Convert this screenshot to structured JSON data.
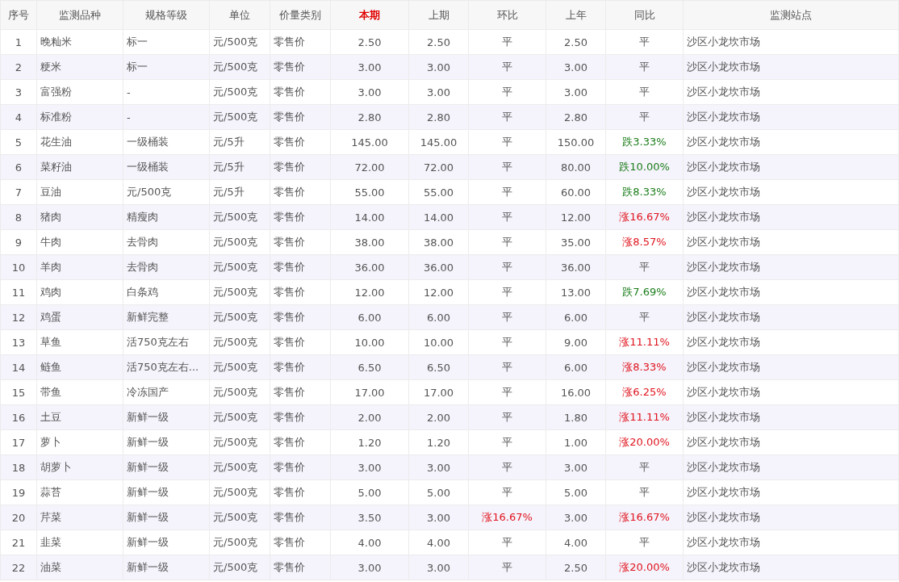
{
  "table": {
    "columns": [
      {
        "label": "序号",
        "highlighted": false
      },
      {
        "label": "监测品种",
        "highlighted": false
      },
      {
        "label": "规格等级",
        "highlighted": false
      },
      {
        "label": "单位",
        "highlighted": false
      },
      {
        "label": "价量类别",
        "highlighted": false
      },
      {
        "label": "本期",
        "highlighted": true
      },
      {
        "label": "上期",
        "highlighted": false
      },
      {
        "label": "环比",
        "highlighted": false
      },
      {
        "label": "上年",
        "highlighted": false
      },
      {
        "label": "同比",
        "highlighted": false
      },
      {
        "label": "监测站点",
        "highlighted": false
      }
    ],
    "rows": [
      {
        "no": "1",
        "item": "晚籼米",
        "grade": "标一",
        "unit": "元/500克",
        "price_type": "零售价",
        "current": "2.50",
        "previous": "2.50",
        "mom": "平",
        "mom_rising": false,
        "mom_falling": false,
        "last_year": "2.50",
        "yoy": "平",
        "yoy_rising": false,
        "yoy_falling": false,
        "station": "沙区小龙坎市场"
      },
      {
        "no": "2",
        "item": "粳米",
        "grade": "标一",
        "unit": "元/500克",
        "price_type": "零售价",
        "current": "3.00",
        "previous": "3.00",
        "mom": "平",
        "mom_rising": false,
        "mom_falling": false,
        "last_year": "3.00",
        "yoy": "平",
        "yoy_rising": false,
        "yoy_falling": false,
        "station": "沙区小龙坎市场"
      },
      {
        "no": "3",
        "item": "富强粉",
        "grade": "-",
        "unit": "元/500克",
        "price_type": "零售价",
        "current": "3.00",
        "previous": "3.00",
        "mom": "平",
        "mom_rising": false,
        "mom_falling": false,
        "last_year": "3.00",
        "yoy": "平",
        "yoy_rising": false,
        "yoy_falling": false,
        "station": "沙区小龙坎市场"
      },
      {
        "no": "4",
        "item": "标准粉",
        "grade": "-",
        "unit": "元/500克",
        "price_type": "零售价",
        "current": "2.80",
        "previous": "2.80",
        "mom": "平",
        "mom_rising": false,
        "mom_falling": false,
        "last_year": "2.80",
        "yoy": "平",
        "yoy_rising": false,
        "yoy_falling": false,
        "station": "沙区小龙坎市场"
      },
      {
        "no": "5",
        "item": "花生油",
        "grade": "一级桶装",
        "unit": "元/5升",
        "price_type": "零售价",
        "current": "145.00",
        "previous": "145.00",
        "mom": "平",
        "mom_rising": false,
        "mom_falling": false,
        "last_year": "150.00",
        "yoy": "跌3.33%",
        "yoy_rising": false,
        "yoy_falling": true,
        "station": "沙区小龙坎市场"
      },
      {
        "no": "6",
        "item": "菜籽油",
        "grade": "一级桶装",
        "unit": "元/5升",
        "price_type": "零售价",
        "current": "72.00",
        "previous": "72.00",
        "mom": "平",
        "mom_rising": false,
        "mom_falling": false,
        "last_year": "80.00",
        "yoy": "跌10.00%",
        "yoy_rising": false,
        "yoy_falling": true,
        "station": "沙区小龙坎市场"
      },
      {
        "no": "7",
        "item": "豆油",
        "grade": "元/500克",
        "unit": "元/5升",
        "price_type": "零售价",
        "current": "55.00",
        "previous": "55.00",
        "mom": "平",
        "mom_rising": false,
        "mom_falling": false,
        "last_year": "60.00",
        "yoy": "跌8.33%",
        "yoy_rising": false,
        "yoy_falling": true,
        "station": "沙区小龙坎市场"
      },
      {
        "no": "8",
        "item": "猪肉",
        "grade": "精瘦肉",
        "unit": "元/500克",
        "price_type": "零售价",
        "current": "14.00",
        "previous": "14.00",
        "mom": "平",
        "mom_rising": false,
        "mom_falling": false,
        "last_year": "12.00",
        "yoy": "涨16.67%",
        "yoy_rising": true,
        "yoy_falling": false,
        "station": "沙区小龙坎市场"
      },
      {
        "no": "9",
        "item": "牛肉",
        "grade": "去骨肉",
        "unit": "元/500克",
        "price_type": "零售价",
        "current": "38.00",
        "previous": "38.00",
        "mom": "平",
        "mom_rising": false,
        "mom_falling": false,
        "last_year": "35.00",
        "yoy": "涨8.57%",
        "yoy_rising": true,
        "yoy_falling": false,
        "station": "沙区小龙坎市场"
      },
      {
        "no": "10",
        "item": "羊肉",
        "grade": "去骨肉",
        "unit": "元/500克",
        "price_type": "零售价",
        "current": "36.00",
        "previous": "36.00",
        "mom": "平",
        "mom_rising": false,
        "mom_falling": false,
        "last_year": "36.00",
        "yoy": "平",
        "yoy_rising": false,
        "yoy_falling": false,
        "station": "沙区小龙坎市场"
      },
      {
        "no": "11",
        "item": "鸡肉",
        "grade": "白条鸡",
        "unit": "元/500克",
        "price_type": "零售价",
        "current": "12.00",
        "previous": "12.00",
        "mom": "平",
        "mom_rising": false,
        "mom_falling": false,
        "last_year": "13.00",
        "yoy": "跌7.69%",
        "yoy_rising": false,
        "yoy_falling": true,
        "station": "沙区小龙坎市场"
      },
      {
        "no": "12",
        "item": "鸡蛋",
        "grade": "新鲜完整",
        "unit": "元/500克",
        "price_type": "零售价",
        "current": "6.00",
        "previous": "6.00",
        "mom": "平",
        "mom_rising": false,
        "mom_falling": false,
        "last_year": "6.00",
        "yoy": "平",
        "yoy_rising": false,
        "yoy_falling": false,
        "station": "沙区小龙坎市场"
      },
      {
        "no": "13",
        "item": "草鱼",
        "grade": "活750克左右",
        "unit": "元/500克",
        "price_type": "零售价",
        "current": "10.00",
        "previous": "10.00",
        "mom": "平",
        "mom_rising": false,
        "mom_falling": false,
        "last_year": "9.00",
        "yoy": "涨11.11%",
        "yoy_rising": true,
        "yoy_falling": false,
        "station": "沙区小龙坎市场"
      },
      {
        "no": "14",
        "item": "鲢鱼",
        "grade": "活750克左右...",
        "unit": "元/500克",
        "price_type": "零售价",
        "current": "6.50",
        "previous": "6.50",
        "mom": "平",
        "mom_rising": false,
        "mom_falling": false,
        "last_year": "6.00",
        "yoy": "涨8.33%",
        "yoy_rising": true,
        "yoy_falling": false,
        "station": "沙区小龙坎市场"
      },
      {
        "no": "15",
        "item": "带鱼",
        "grade": "冷冻国产",
        "unit": "元/500克",
        "price_type": "零售价",
        "current": "17.00",
        "previous": "17.00",
        "mom": "平",
        "mom_rising": false,
        "mom_falling": false,
        "last_year": "16.00",
        "yoy": "涨6.25%",
        "yoy_rising": true,
        "yoy_falling": false,
        "station": "沙区小龙坎市场"
      },
      {
        "no": "16",
        "item": "土豆",
        "grade": "新鲜一级",
        "unit": "元/500克",
        "price_type": "零售价",
        "current": "2.00",
        "previous": "2.00",
        "mom": "平",
        "mom_rising": false,
        "mom_falling": false,
        "last_year": "1.80",
        "yoy": "涨11.11%",
        "yoy_rising": true,
        "yoy_falling": false,
        "station": "沙区小龙坎市场"
      },
      {
        "no": "17",
        "item": "萝卜",
        "grade": "新鲜一级",
        "unit": "元/500克",
        "price_type": "零售价",
        "current": "1.20",
        "previous": "1.20",
        "mom": "平",
        "mom_rising": false,
        "mom_falling": false,
        "last_year": "1.00",
        "yoy": "涨20.00%",
        "yoy_rising": true,
        "yoy_falling": false,
        "station": "沙区小龙坎市场"
      },
      {
        "no": "18",
        "item": "胡萝卜",
        "grade": "新鲜一级",
        "unit": "元/500克",
        "price_type": "零售价",
        "current": "3.00",
        "previous": "3.00",
        "mom": "平",
        "mom_rising": false,
        "mom_falling": false,
        "last_year": "3.00",
        "yoy": "平",
        "yoy_rising": false,
        "yoy_falling": false,
        "station": "沙区小龙坎市场"
      },
      {
        "no": "19",
        "item": "蒜苔",
        "grade": "新鲜一级",
        "unit": "元/500克",
        "price_type": "零售价",
        "current": "5.00",
        "previous": "5.00",
        "mom": "平",
        "mom_rising": false,
        "mom_falling": false,
        "last_year": "5.00",
        "yoy": "平",
        "yoy_rising": false,
        "yoy_falling": false,
        "station": "沙区小龙坎市场"
      },
      {
        "no": "20",
        "item": "芹菜",
        "grade": "新鲜一级",
        "unit": "元/500克",
        "price_type": "零售价",
        "current": "3.50",
        "previous": "3.00",
        "mom": "涨16.67%",
        "mom_rising": true,
        "mom_falling": false,
        "last_year": "3.00",
        "yoy": "涨16.67%",
        "yoy_rising": true,
        "yoy_falling": false,
        "station": "沙区小龙坎市场"
      },
      {
        "no": "21",
        "item": "韭菜",
        "grade": "新鲜一级",
        "unit": "元/500克",
        "price_type": "零售价",
        "current": "4.00",
        "previous": "4.00",
        "mom": "平",
        "mom_rising": false,
        "mom_falling": false,
        "last_year": "4.00",
        "yoy": "平",
        "yoy_rising": false,
        "yoy_falling": false,
        "station": "沙区小龙坎市场"
      },
      {
        "no": "22",
        "item": "油菜",
        "grade": "新鲜一级",
        "unit": "元/500克",
        "price_type": "零售价",
        "current": "3.00",
        "previous": "3.00",
        "mom": "平",
        "mom_rising": false,
        "mom_falling": false,
        "last_year": "2.50",
        "yoy": "涨20.00%",
        "yoy_rising": true,
        "yoy_falling": false,
        "station": "沙区小龙坎市场"
      }
    ]
  }
}
